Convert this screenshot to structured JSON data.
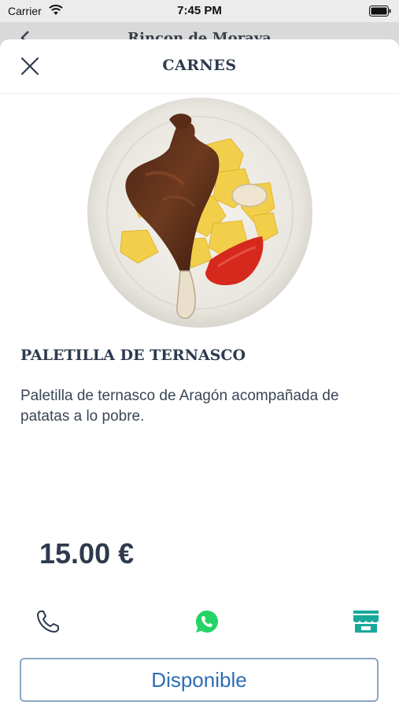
{
  "status_bar": {
    "carrier": "Carrier",
    "time": "7:45 PM"
  },
  "background_page": {
    "title": "Rincon de Moraya"
  },
  "sheet": {
    "title": "CARNES",
    "dish": {
      "name": "PALETILLA DE TERNASCO",
      "description": "Paletilla de ternasco de Aragón acompañada de patatas a lo pobre.",
      "price": "15.00 €"
    },
    "actions": {
      "phone_icon": "phone-icon",
      "whatsapp_icon": "whatsapp-icon",
      "store_icon": "store-icon"
    },
    "availability_button": "Disponible"
  },
  "colors": {
    "title_text": "#2e3a4e",
    "link_blue": "#2e6db4",
    "whatsapp_green": "#25d366",
    "store_teal": "#17a99a"
  }
}
